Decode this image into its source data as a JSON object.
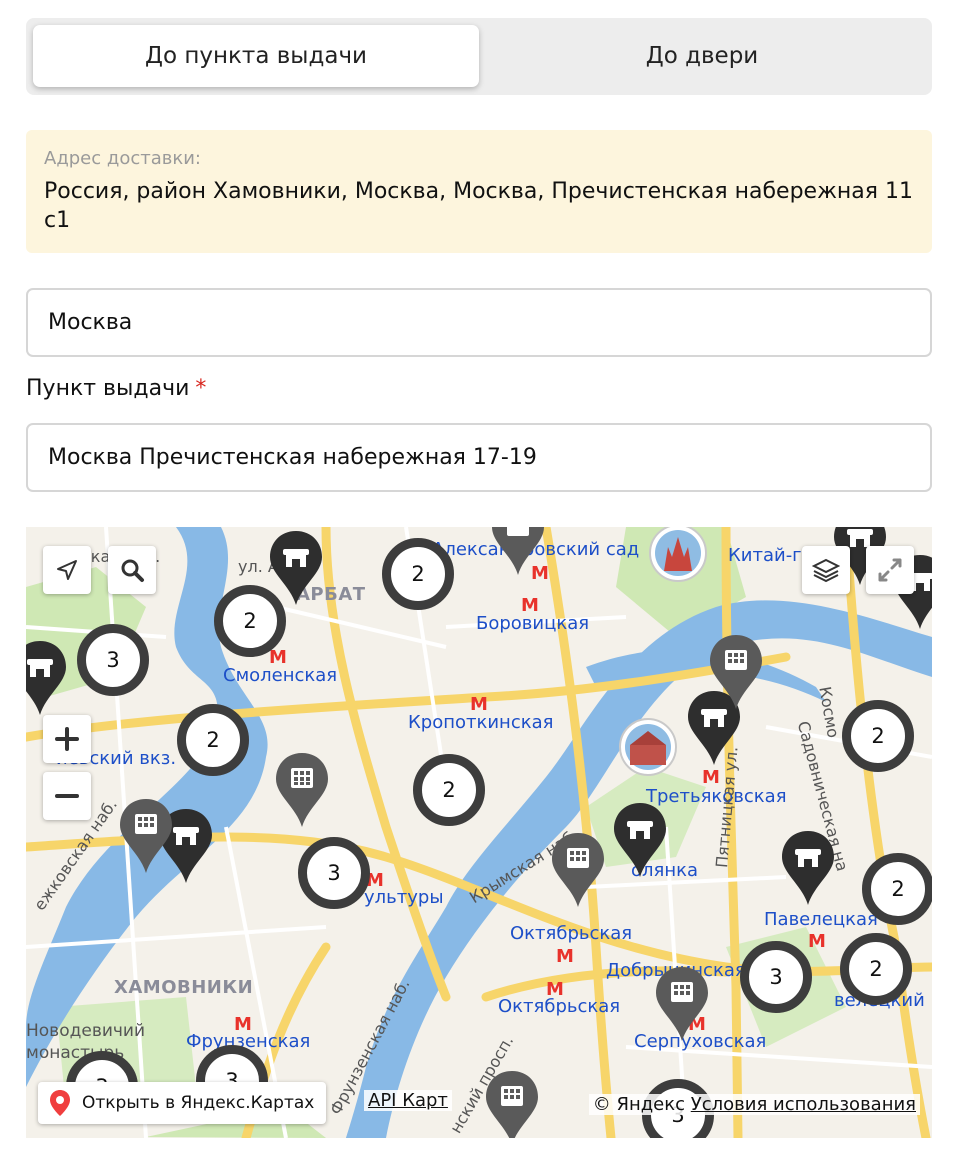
{
  "delivery_tabs": {
    "pickup_label": "До пункта выдачи",
    "door_label": "До двери"
  },
  "address": {
    "label": "Адрес доставки:",
    "value": "Россия, район Хамовники, Москва, Москва, Пречистенская набережная 11 с1"
  },
  "city_field": {
    "value": "Москва"
  },
  "pickup_point": {
    "label": "Пункт выдачи",
    "required_mark": "*",
    "value": "Москва Пречистенская набережная 17-19"
  },
  "map": {
    "metro_stations": [
      "Александровский сад",
      "Китай-город",
      "Боровицкая",
      "Смоленская",
      "Кропоткинская",
      "Третьяковская",
      "Полянка",
      "Парк Культуры",
      "Октябрьская",
      "Октябрьская",
      "Павелецкая",
      "Добрынинская",
      "Фрунзенская",
      "Серпуховская"
    ],
    "metro_labels": {
      "aleksandrovsky": "Александровский сад",
      "kitay_gorod": "Китай-го",
      "borovitskaya": "Боровицкая",
      "smolenskaya": "Смоленская",
      "kropotkinskaya": "Кропоткинская",
      "tretyakovskaya": "Третьяковская",
      "polyanka": "олянка",
      "park_kultury": "ультуры",
      "oktyabrskaya_1": "Октябрьская",
      "oktyabrskaya_2": "Октябрьская",
      "paveletskaya": "Павелецкая",
      "dobryninskaya": "Добрынинская",
      "frunzenskaya": "Фрунзенская",
      "serpukhovskaya": "Серпуховская",
      "kievsky": "иевский вкз.",
      "paveletsky_vkz": "велецкий вкз"
    },
    "district_labels": {
      "arbat": "АРБАТ",
      "khamovniki": "ХАМОВНИКИ"
    },
    "street_labels": {
      "arbat_st": "ул. Арба",
      "pyatnitskaya": "Пятницкая ул.",
      "sadovnicheskaya": "Садовническая на",
      "krymskaya": "Крымская наб.",
      "kosmodamianskaya": "Космо",
      "novodevichy_1": "Новодевичий",
      "novodevichy_2": "монастырь",
      "nab": "ская наб.",
      "frunzenskaya_nab": "Фрунзенская наб.",
      "berezhk": "ежковская наб.",
      "lenprosp": "нский просп."
    },
    "clusters": [
      {
        "id": "c1",
        "count": "2"
      },
      {
        "id": "c2",
        "count": "2"
      },
      {
        "id": "c3",
        "count": "3"
      },
      {
        "id": "c4",
        "count": "2"
      },
      {
        "id": "c5",
        "count": "2"
      },
      {
        "id": "c6",
        "count": "3"
      },
      {
        "id": "c7",
        "count": "2"
      },
      {
        "id": "c8",
        "count": "2"
      },
      {
        "id": "c9",
        "count": "3"
      },
      {
        "id": "c10",
        "count": "2"
      },
      {
        "id": "c11",
        "count": "3"
      },
      {
        "id": "c12",
        "count": "3"
      },
      {
        "id": "c13",
        "count": "3"
      }
    ],
    "open_in_yandex_label": "Открыть в Яндекс.Картах",
    "api_link_label": "API Карт",
    "copyright_label": "© Яндекс",
    "terms_label": "Условия использования",
    "colors": {
      "water": "#88b9e6",
      "park": "#cfe8b4",
      "road_major": "#f7d56a",
      "metro": "#1d4fc8",
      "metro_marker": "#e8322b",
      "cluster_ring": "#3d3d3d",
      "pin_dark": "#2e2e2e",
      "pin_gray": "#5a5a5a",
      "location_pin": "#f03e3e"
    },
    "icons": [
      "geolocation-icon",
      "search-icon",
      "layers-icon",
      "fullscreen-icon",
      "zoom-in-icon",
      "zoom-out-icon",
      "store-icon",
      "grid-locker-icon",
      "map-pin-icon"
    ]
  }
}
